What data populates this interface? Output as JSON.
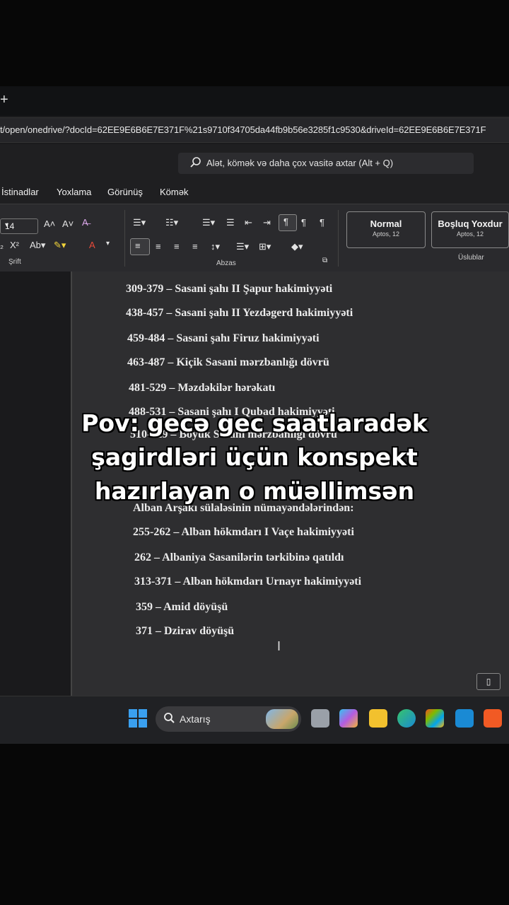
{
  "browser": {
    "new_tab_glyph": "+",
    "url": "t/open/onedrive/?docId=62EE9E6B6E7E371F%21s9710f34705da44fb9b56e3285f1c9530&driveId=62EE9E6B6E7E371F"
  },
  "search": {
    "placeholder": "Alət, kömək və daha çox vasitə axtar (Alt + Q)"
  },
  "menu": {
    "items": [
      "İstinadlar",
      "Yoxlama",
      "Görünüş",
      "Kömək"
    ]
  },
  "ribbon": {
    "font_size": "14",
    "groups": {
      "font": "Şrift",
      "paragraph": "Abzas",
      "styles": "Üslublar"
    },
    "styles": [
      {
        "name": "Normal",
        "sub": "Aptos, 12"
      },
      {
        "name": "Boşluq Yoxdur",
        "sub": "Aptos, 12"
      }
    ]
  },
  "document": {
    "lines": [
      "309-379 – Sasani şahı II Şapur hakimiyyəti",
      "438-457 – Sasani şahı II Yezdəgerd hakimiyyəti",
      "459-484 – Sasani şahı Firuz hakimiyyəti",
      "463-487 – Kiçik Sasani mərzbanlığı dövrü",
      "481-529 – Məzdəkilər hərəkatı",
      "488-531 – Sasani şahı I Qubad hakimiyyəti",
      "510-629 – Böyük Sasani mərzbanlığı dövrü",
      "Alban Arşakı sülaləsinin nümayəndələrindən:",
      "255-262 – Alban hökmdarı I Vaçe hakimiyyəti",
      "262 – Albaniya Sasanilərin tərkibinə qatıldı",
      "313-371 – Alban hökmdarı Urnayr hakimiyyəti",
      "359 – Amid döyüşü",
      "371 – Dzirav döyüşü"
    ]
  },
  "caption": {
    "line1": "Pov: gecə gec saatlaradək",
    "line2": "şagirdləri üçün konspekt",
    "line3": "hazırlayan o müəllimsən"
  },
  "taskbar": {
    "search_label": "Axtarış"
  },
  "colors": {
    "edge_blue": "#1a8ad4",
    "files_yellow": "#f2c12e",
    "brave_orange": "#f15a24",
    "win_blue": "#3aa0f0"
  }
}
